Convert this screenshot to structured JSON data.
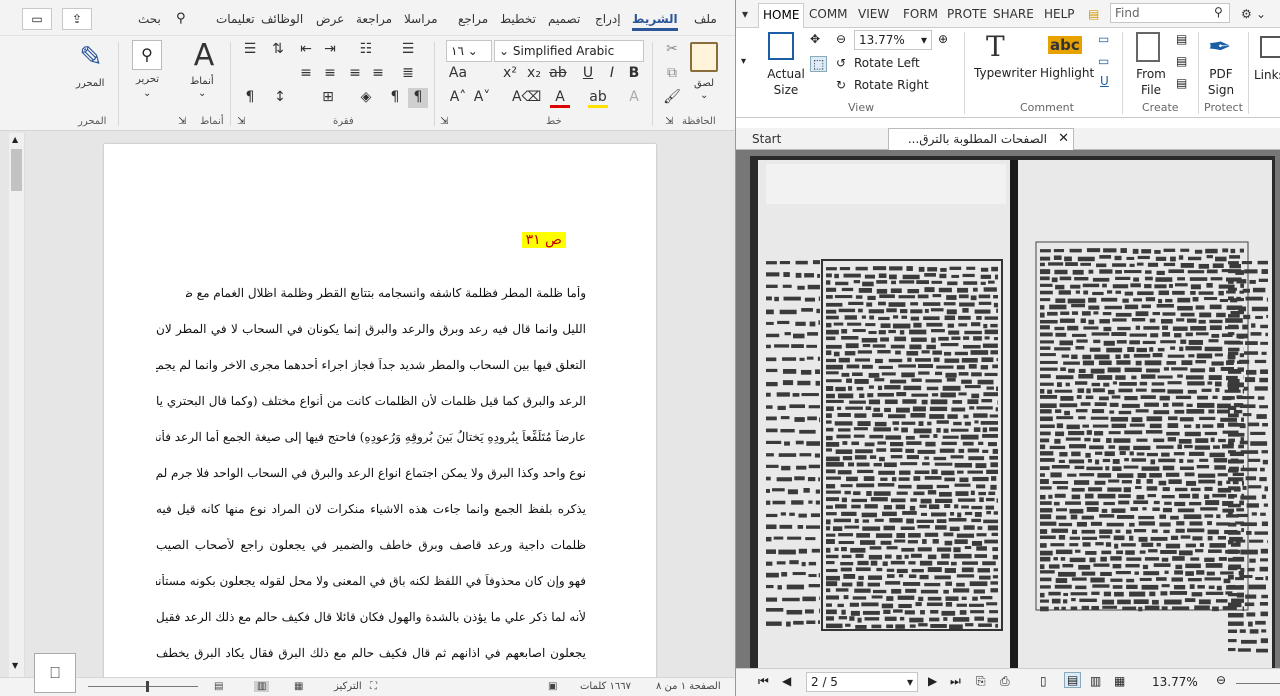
{
  "word": {
    "tabs": [
      {
        "label": "ملف"
      },
      {
        "label": "الشريط"
      },
      {
        "label": "إدراج"
      },
      {
        "label": "تصميم"
      },
      {
        "label": "تخطيط"
      },
      {
        "label": "مراجع"
      },
      {
        "label": "مراسلا"
      },
      {
        "label": "مراجعة"
      },
      {
        "label": "عرض"
      },
      {
        "label": "الوظائف"
      },
      {
        "label": "تعليمات"
      },
      {
        "label": "بحث"
      }
    ],
    "groups": {
      "clipboard": "الحافظة",
      "font": "خط",
      "paragraph": "فقرة",
      "styles": "أنماط",
      "editor": "المحرر"
    },
    "paste_label": "لصق",
    "styles_label": "أنماط",
    "editing_label": "تحرير",
    "editor_label": "المحرر",
    "font_name": "Simplified Arabic",
    "font_size": "١٦",
    "page_label": "ص ٣١",
    "lines": [
      "وأما ظلمة المطر فظلمة كاشفه وانسجامه بتتابع القطر وظلمة اظلال الغمام مع ظلمة",
      "الليل وانما قال فيه رعد وبرق والرعد والبرق إنما يكونان في السحاب لا في المطر لان",
      "التعلق فيها بين السحاب والمطر شديد جداً فجاز اجراء أحدهما مجرى الاخر وانما لم يجمع",
      "الرعد والبرق كما قيل ظلمات لأن الظلمات كانت من أنواع مختلف (وكما قال البحتري يا",
      "عارضاً مُتَلَفِّعاً بِبُرودِهِ يَختالُ بَينَ بُروقِهِ وَرُعودِهِ) فاحتج فيها إلى صيغة الجمع أما الرعد فأنه",
      "نوع واحد وكذا البرق ولا يمكن اجتماع انواع الرعد والبرق في السحاب الواحد فلا جرم لم",
      "يذكره بلفظ الجمع وانما جاءت هذه الاشياء منكرات لان المراد نوع منها كانه قيل فيه",
      "ظلمات داجية ورعد قاصف وبرق خاطف والضمير في يجعلون راجع لأصحاب الصيب",
      "فهو وإن كان محذوفاً في اللفظ لكنه باق في المعنى ولا محل لقوله يجعلون بكونه مستأنفا",
      "لأنه لما ذكر علي ما يؤذن بالشدة والهول فكان قائلا قال فكيف حالم مع ذلك الرعد فقيل",
      "يجعلون اصابعهم في اذانهم ثم قال فكيف حالم مع ذلك البرق فقال يكاد البرق يخطف"
    ],
    "status": {
      "page": "الصفحة ١ من ٨",
      "words": "١٦٦٧ كلمات",
      "focus": "التركيز"
    }
  },
  "foxit": {
    "tabs": [
      {
        "label": "HOME"
      },
      {
        "label": "COMM"
      },
      {
        "label": "VIEW"
      },
      {
        "label": "FORM"
      },
      {
        "label": "PROTE"
      },
      {
        "label": "SHARE"
      },
      {
        "label": "HELP"
      }
    ],
    "search_placeholder": "Find",
    "zoom": "13.77%",
    "actual_size": "Actual Size",
    "rotate_left": "Rotate Left",
    "rotate_right": "Rotate Right",
    "group_view": "View",
    "typewriter": "Typewriter",
    "highlight": "Highlight",
    "group_comment": "Comment",
    "from_file": "From File",
    "group_create": "Create",
    "pdf_sign": "PDF Sign",
    "group_protect": "Protect",
    "links": "Links",
    "doc_tabs": [
      {
        "label": "Start"
      },
      {
        "label": "الصفحات المطلوبة بالترق..."
      }
    ],
    "page_nav": "2 / 5",
    "status_zoom": "13.77%"
  },
  "colors": {
    "word_accent": "#2b579a",
    "foxit_accent": "#1a5ea8",
    "highlight": "#ffff00",
    "page_label_text": "#c00000"
  }
}
